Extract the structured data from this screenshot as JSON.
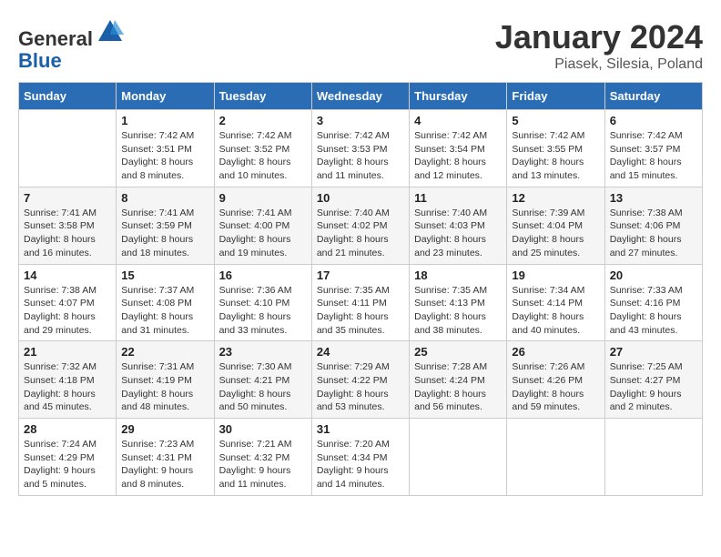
{
  "header": {
    "logo_line1": "General",
    "logo_line2": "Blue",
    "title": "January 2024",
    "subtitle": "Piasek, Silesia, Poland"
  },
  "columns": [
    "Sunday",
    "Monday",
    "Tuesday",
    "Wednesday",
    "Thursday",
    "Friday",
    "Saturday"
  ],
  "weeks": [
    [
      {
        "day": "",
        "info": ""
      },
      {
        "day": "1",
        "info": "Sunrise: 7:42 AM\nSunset: 3:51 PM\nDaylight: 8 hours\nand 8 minutes."
      },
      {
        "day": "2",
        "info": "Sunrise: 7:42 AM\nSunset: 3:52 PM\nDaylight: 8 hours\nand 10 minutes."
      },
      {
        "day": "3",
        "info": "Sunrise: 7:42 AM\nSunset: 3:53 PM\nDaylight: 8 hours\nand 11 minutes."
      },
      {
        "day": "4",
        "info": "Sunrise: 7:42 AM\nSunset: 3:54 PM\nDaylight: 8 hours\nand 12 minutes."
      },
      {
        "day": "5",
        "info": "Sunrise: 7:42 AM\nSunset: 3:55 PM\nDaylight: 8 hours\nand 13 minutes."
      },
      {
        "day": "6",
        "info": "Sunrise: 7:42 AM\nSunset: 3:57 PM\nDaylight: 8 hours\nand 15 minutes."
      }
    ],
    [
      {
        "day": "7",
        "info": "Sunrise: 7:41 AM\nSunset: 3:58 PM\nDaylight: 8 hours\nand 16 minutes."
      },
      {
        "day": "8",
        "info": "Sunrise: 7:41 AM\nSunset: 3:59 PM\nDaylight: 8 hours\nand 18 minutes."
      },
      {
        "day": "9",
        "info": "Sunrise: 7:41 AM\nSunset: 4:00 PM\nDaylight: 8 hours\nand 19 minutes."
      },
      {
        "day": "10",
        "info": "Sunrise: 7:40 AM\nSunset: 4:02 PM\nDaylight: 8 hours\nand 21 minutes."
      },
      {
        "day": "11",
        "info": "Sunrise: 7:40 AM\nSunset: 4:03 PM\nDaylight: 8 hours\nand 23 minutes."
      },
      {
        "day": "12",
        "info": "Sunrise: 7:39 AM\nSunset: 4:04 PM\nDaylight: 8 hours\nand 25 minutes."
      },
      {
        "day": "13",
        "info": "Sunrise: 7:38 AM\nSunset: 4:06 PM\nDaylight: 8 hours\nand 27 minutes."
      }
    ],
    [
      {
        "day": "14",
        "info": "Sunrise: 7:38 AM\nSunset: 4:07 PM\nDaylight: 8 hours\nand 29 minutes."
      },
      {
        "day": "15",
        "info": "Sunrise: 7:37 AM\nSunset: 4:08 PM\nDaylight: 8 hours\nand 31 minutes."
      },
      {
        "day": "16",
        "info": "Sunrise: 7:36 AM\nSunset: 4:10 PM\nDaylight: 8 hours\nand 33 minutes."
      },
      {
        "day": "17",
        "info": "Sunrise: 7:35 AM\nSunset: 4:11 PM\nDaylight: 8 hours\nand 35 minutes."
      },
      {
        "day": "18",
        "info": "Sunrise: 7:35 AM\nSunset: 4:13 PM\nDaylight: 8 hours\nand 38 minutes."
      },
      {
        "day": "19",
        "info": "Sunrise: 7:34 AM\nSunset: 4:14 PM\nDaylight: 8 hours\nand 40 minutes."
      },
      {
        "day": "20",
        "info": "Sunrise: 7:33 AM\nSunset: 4:16 PM\nDaylight: 8 hours\nand 43 minutes."
      }
    ],
    [
      {
        "day": "21",
        "info": "Sunrise: 7:32 AM\nSunset: 4:18 PM\nDaylight: 8 hours\nand 45 minutes."
      },
      {
        "day": "22",
        "info": "Sunrise: 7:31 AM\nSunset: 4:19 PM\nDaylight: 8 hours\nand 48 minutes."
      },
      {
        "day": "23",
        "info": "Sunrise: 7:30 AM\nSunset: 4:21 PM\nDaylight: 8 hours\nand 50 minutes."
      },
      {
        "day": "24",
        "info": "Sunrise: 7:29 AM\nSunset: 4:22 PM\nDaylight: 8 hours\nand 53 minutes."
      },
      {
        "day": "25",
        "info": "Sunrise: 7:28 AM\nSunset: 4:24 PM\nDaylight: 8 hours\nand 56 minutes."
      },
      {
        "day": "26",
        "info": "Sunrise: 7:26 AM\nSunset: 4:26 PM\nDaylight: 8 hours\nand 59 minutes."
      },
      {
        "day": "27",
        "info": "Sunrise: 7:25 AM\nSunset: 4:27 PM\nDaylight: 9 hours\nand 2 minutes."
      }
    ],
    [
      {
        "day": "28",
        "info": "Sunrise: 7:24 AM\nSunset: 4:29 PM\nDaylight: 9 hours\nand 5 minutes."
      },
      {
        "day": "29",
        "info": "Sunrise: 7:23 AM\nSunset: 4:31 PM\nDaylight: 9 hours\nand 8 minutes."
      },
      {
        "day": "30",
        "info": "Sunrise: 7:21 AM\nSunset: 4:32 PM\nDaylight: 9 hours\nand 11 minutes."
      },
      {
        "day": "31",
        "info": "Sunrise: 7:20 AM\nSunset: 4:34 PM\nDaylight: 9 hours\nand 14 minutes."
      },
      {
        "day": "",
        "info": ""
      },
      {
        "day": "",
        "info": ""
      },
      {
        "day": "",
        "info": ""
      }
    ]
  ]
}
